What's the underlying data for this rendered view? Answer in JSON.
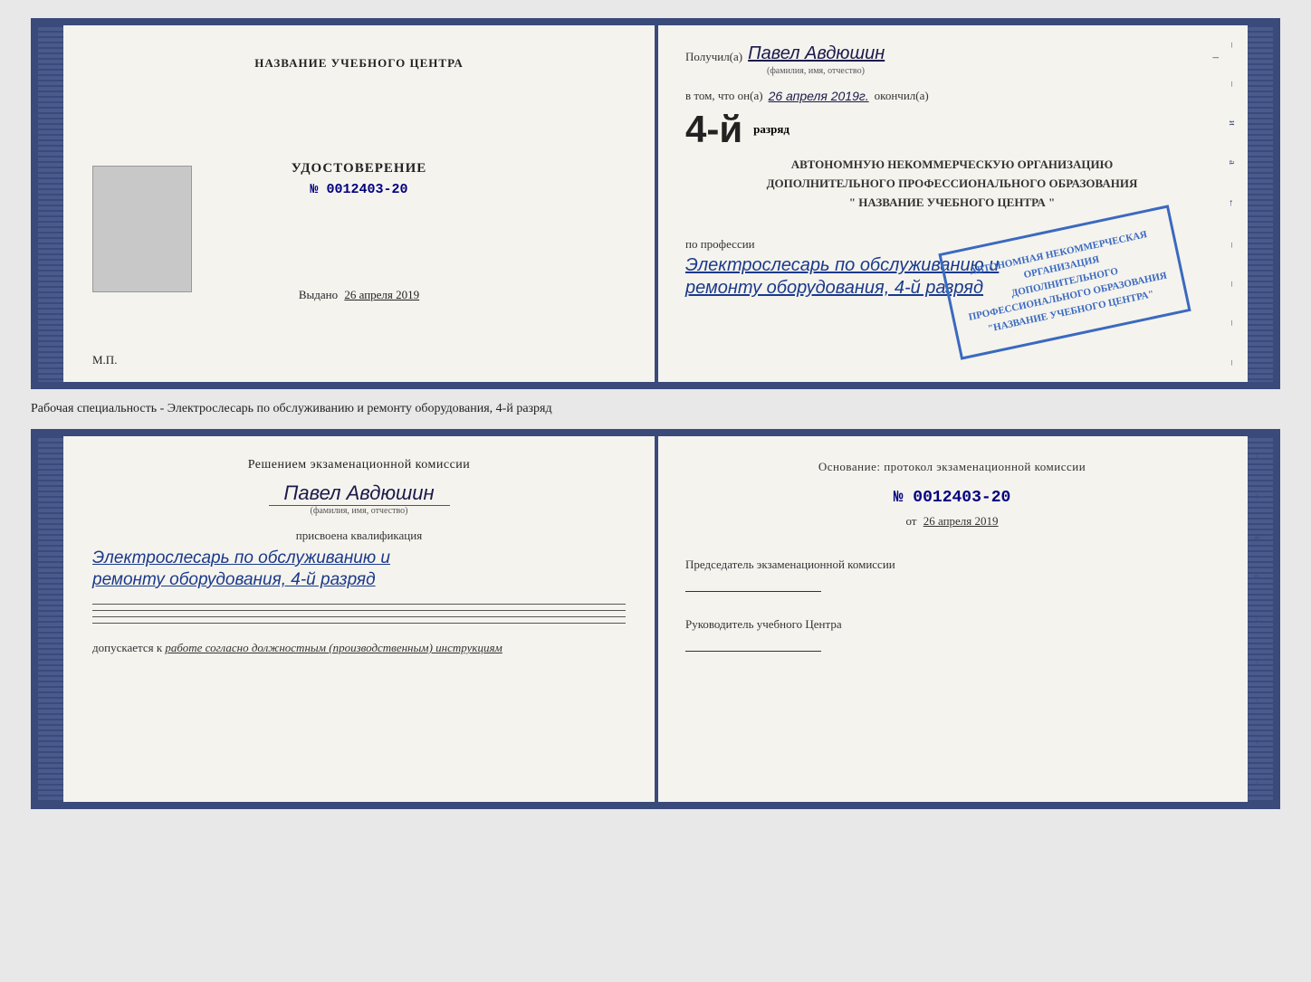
{
  "top_doc": {
    "left": {
      "title": "НАЗВАНИЕ УЧЕБНОГО ЦЕНТРА",
      "udostoverenie": "УДОСТОВЕРЕНИЕ",
      "number": "№ 0012403-20",
      "vydano": "Выдано",
      "vydano_date": "26 апреля 2019",
      "mp": "М.П."
    },
    "right": {
      "poluchil_prefix": "Получил(а)",
      "name": "Павел Авдюшин",
      "name_sublabel": "(фамилия, имя, отчество)",
      "vtom_prefix": "в том, что он(а)",
      "date_handwritten": "26 апреля 2019г.",
      "okoncil": "окончил(а)",
      "rank_number": "4-й",
      "rank_suffix": "разряд",
      "org_line1": "АВТОНОМНУЮ НЕКОММЕРЧЕСКУЮ ОРГАНИЗАЦИЮ",
      "org_line2": "ДОПОЛНИТЕЛЬНОГО ПРОФЕССИОНАЛЬНОГО ОБРАЗОВАНИЯ",
      "org_line3": "\" НАЗВАНИЕ УЧЕБНОГО ЦЕНТРА \"",
      "po_professii": "по профессии",
      "profession_line1": "Электрослесарь по обслуживанию и",
      "profession_line2": "ремонту оборудования, 4-й разряд"
    }
  },
  "middle": {
    "text": "Рабочая специальность - Электрослесарь по обслуживанию и ремонту оборудования, 4-й разряд"
  },
  "bottom_doc": {
    "left": {
      "komissia_title": "Решением экзаменационной комиссии",
      "name": "Павел Авдюшин",
      "name_sublabel": "(фамилия, имя, отчество)",
      "prisvoena": "присвоена квалификация",
      "qualification_line1": "Электрослесарь по обслуживанию и",
      "qualification_line2": "ремонту оборудования, 4-й разряд",
      "dopuskaetsya_prefix": "допускается к",
      "dopuskaetsya_text": "работе согласно должностным (производственным) инструкциям"
    },
    "right": {
      "osnovanie": "Основание: протокол экзаменационной комиссии",
      "number": "№ 0012403-20",
      "ot_prefix": "от",
      "ot_date": "26 апреля 2019",
      "predsedatel_label": "Председатель экзаменационной комиссии",
      "rukovoditel_label": "Руководитель учебного Центра"
    }
  },
  "side_chars": {
    "chars": [
      "и",
      "а",
      "←",
      "–",
      "–",
      "–",
      "–",
      "–"
    ]
  }
}
